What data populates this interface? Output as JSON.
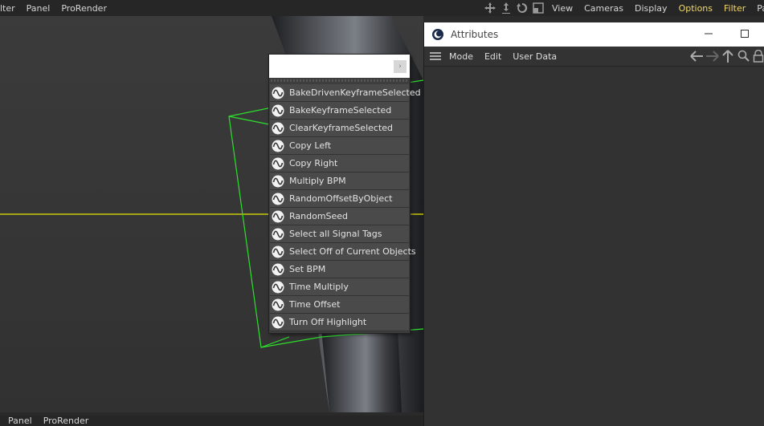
{
  "top_menu_left": [
    "lter",
    "Panel",
    "ProRender"
  ],
  "top_menu_right": [
    {
      "label": "View",
      "highlight": false
    },
    {
      "label": "Cameras",
      "highlight": false
    },
    {
      "label": "Display",
      "highlight": false
    },
    {
      "label": "Options",
      "highlight": true
    },
    {
      "label": "Filter",
      "highlight": true
    },
    {
      "label": "Panel",
      "highlight": false
    }
  ],
  "bottom_menu": [
    "Panel",
    "ProRender"
  ],
  "attributes": {
    "title": "Attributes",
    "menu": [
      "Mode",
      "Edit",
      "User Data"
    ]
  },
  "popup": {
    "search_value": "",
    "items": [
      "BakeDrivenKeyframeSelected",
      "BakeKeyframeSelected",
      "ClearKeyframeSelected",
      "Copy Left",
      "Copy Right",
      "Multiply BPM",
      "RandomOffsetByObject",
      "RandomSeed",
      "Select all Signal Tags",
      "Select Off of Current Objects",
      "Set BPM",
      "Time Multiply",
      "Time Offset",
      "Turn Off Highlight"
    ],
    "item_icon": "signal-wave-icon"
  },
  "colors": {
    "highlight_menu": "#f1d96a",
    "bounding_box": "#2ee02e",
    "horizon_line": "#e6e600",
    "viewport_bg": "#383838"
  }
}
